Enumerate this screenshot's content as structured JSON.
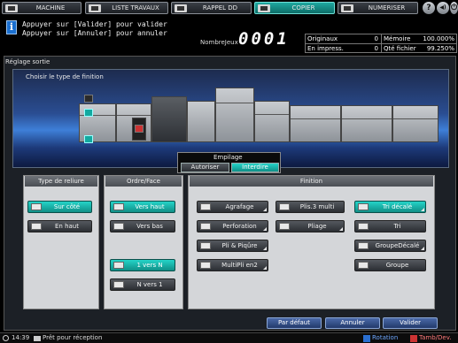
{
  "tabs": [
    {
      "label": "MACHINE",
      "icon": "machine-icon"
    },
    {
      "label": "LISTE TRAVAUX",
      "icon": "job-list-icon"
    },
    {
      "label": "RAPPEL DD",
      "icon": "hdd-recall-icon"
    },
    {
      "label": "COPIER",
      "icon": "copier-icon",
      "active": true
    },
    {
      "label": "NUMERISER",
      "icon": "scanner-icon"
    }
  ],
  "top_buttons": {
    "help": "?",
    "sound": "◀)",
    "power": "⏻"
  },
  "message": {
    "line1": "Appuyer sur [Valider] pour valider",
    "line2": "Appuyer sur [Annuler] pour annuler"
  },
  "jobs": {
    "label": "NombreJeux",
    "value": "0001"
  },
  "counters": {
    "originaux_label": "Originaux",
    "originaux_value": "0",
    "memoire_label": "Mémoire",
    "memoire_value": "100.000%",
    "en_impress_label": "En impress.",
    "en_impress_value": "0",
    "qte_fichier_label": "Qté fichier",
    "qte_fichier_value": "99.250%"
  },
  "screen_title": "Réglage sortie",
  "preview": {
    "title": "Choisir le type de finition"
  },
  "empilage": {
    "label": "Empilage",
    "options": [
      "Autoriser",
      "Interdire"
    ],
    "selected": "Interdire"
  },
  "groups": {
    "reliure": {
      "title": "Type de reliure",
      "buttons": [
        {
          "label": "Sur côté",
          "selected": true
        },
        {
          "label": "En haut",
          "selected": false
        }
      ]
    },
    "ordre": {
      "title": "Ordre/Face",
      "buttons": [
        {
          "label": "Vers haut",
          "selected": true
        },
        {
          "label": "Vers bas",
          "selected": false
        },
        {
          "label": "1 vers N",
          "selected": true
        },
        {
          "label": "N vers 1",
          "selected": false
        }
      ]
    },
    "finition": {
      "title": "Finition",
      "buttons": [
        {
          "label": "Agrafage",
          "selected": false
        },
        {
          "label": "Perforation",
          "selected": false
        },
        {
          "label": "Pli & Piqûre",
          "selected": false
        },
        {
          "label": "MultiPli en2",
          "selected": false
        },
        {
          "label": "Plis.3 multi",
          "selected": false
        },
        {
          "label": "Pliage",
          "selected": false
        },
        {
          "label": "Tri décalé",
          "selected": true
        },
        {
          "label": "Tri",
          "selected": false
        },
        {
          "label": "GroupeDécalé",
          "selected": false
        },
        {
          "label": "Groupe",
          "selected": false
        }
      ]
    }
  },
  "bottom_buttons": {
    "default": "Par défaut",
    "cancel": "Annuler",
    "ok": "Valider"
  },
  "status": {
    "time": "14:39",
    "text": "Prêt pour réception",
    "rotation": "Rotation",
    "tamb": "Tamb/Dev."
  }
}
